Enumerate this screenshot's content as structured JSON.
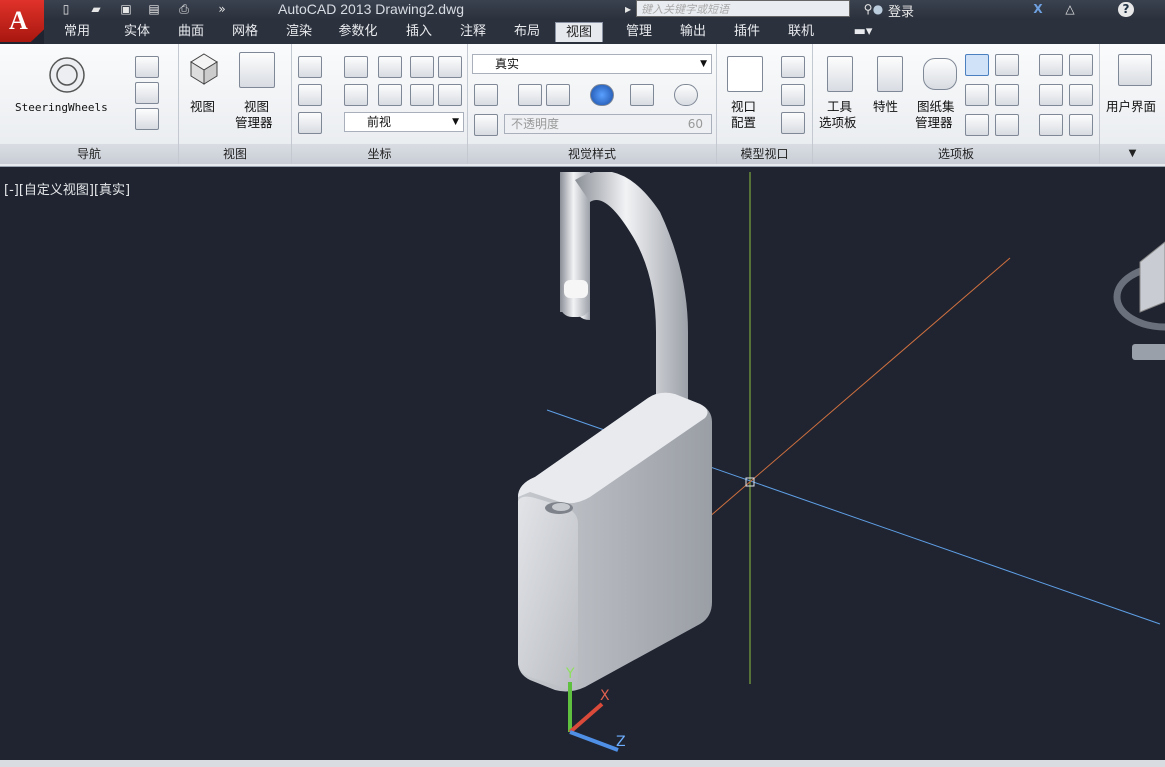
{
  "app": {
    "logo_letter": "A",
    "title": "AutoCAD 2013    Drawing2.dwg",
    "search_placeholder": "键入关键字或短语",
    "login": "登录",
    "help": "?"
  },
  "menu": {
    "tabs": [
      "常用",
      "实体",
      "曲面",
      "网格",
      "渲染",
      "参数化",
      "插入",
      "注释",
      "布局",
      "视图",
      "管理",
      "输出",
      "插件",
      "联机"
    ],
    "active": "视图"
  },
  "ribbon": {
    "panels": {
      "nav": "导航",
      "view": "视图",
      "coords": "坐标",
      "visual": "视觉样式",
      "model_viewports": "模型视口",
      "palettes": "选项板"
    },
    "steering_wheels": "SteeringWheels",
    "view_btn": "视图",
    "view_manager": "视图\n管理器",
    "view_manager_1": "视图",
    "view_manager_2": "管理器",
    "front_view": "前视",
    "visual_style": "真实",
    "opacity_label": "不透明度",
    "opacity_value": "60",
    "viewport_config_1": "视口",
    "viewport_config_2": "配置",
    "tool_palette_1": "工具",
    "tool_palette_2": "选项板",
    "properties": "特性",
    "sheet_set_1": "图纸集",
    "sheet_set_2": "管理器",
    "user_interface": "用户界面"
  },
  "viewport": {
    "label": "[-][自定义视图][真实]",
    "ucs": {
      "x": "X",
      "y": "Y",
      "z": "Z"
    }
  },
  "colors": {
    "viewport_bg": "#1f2430",
    "axis_x": "#d0703f",
    "axis_y": "#8fbf3f",
    "axis_z": "#5f9fe6"
  }
}
